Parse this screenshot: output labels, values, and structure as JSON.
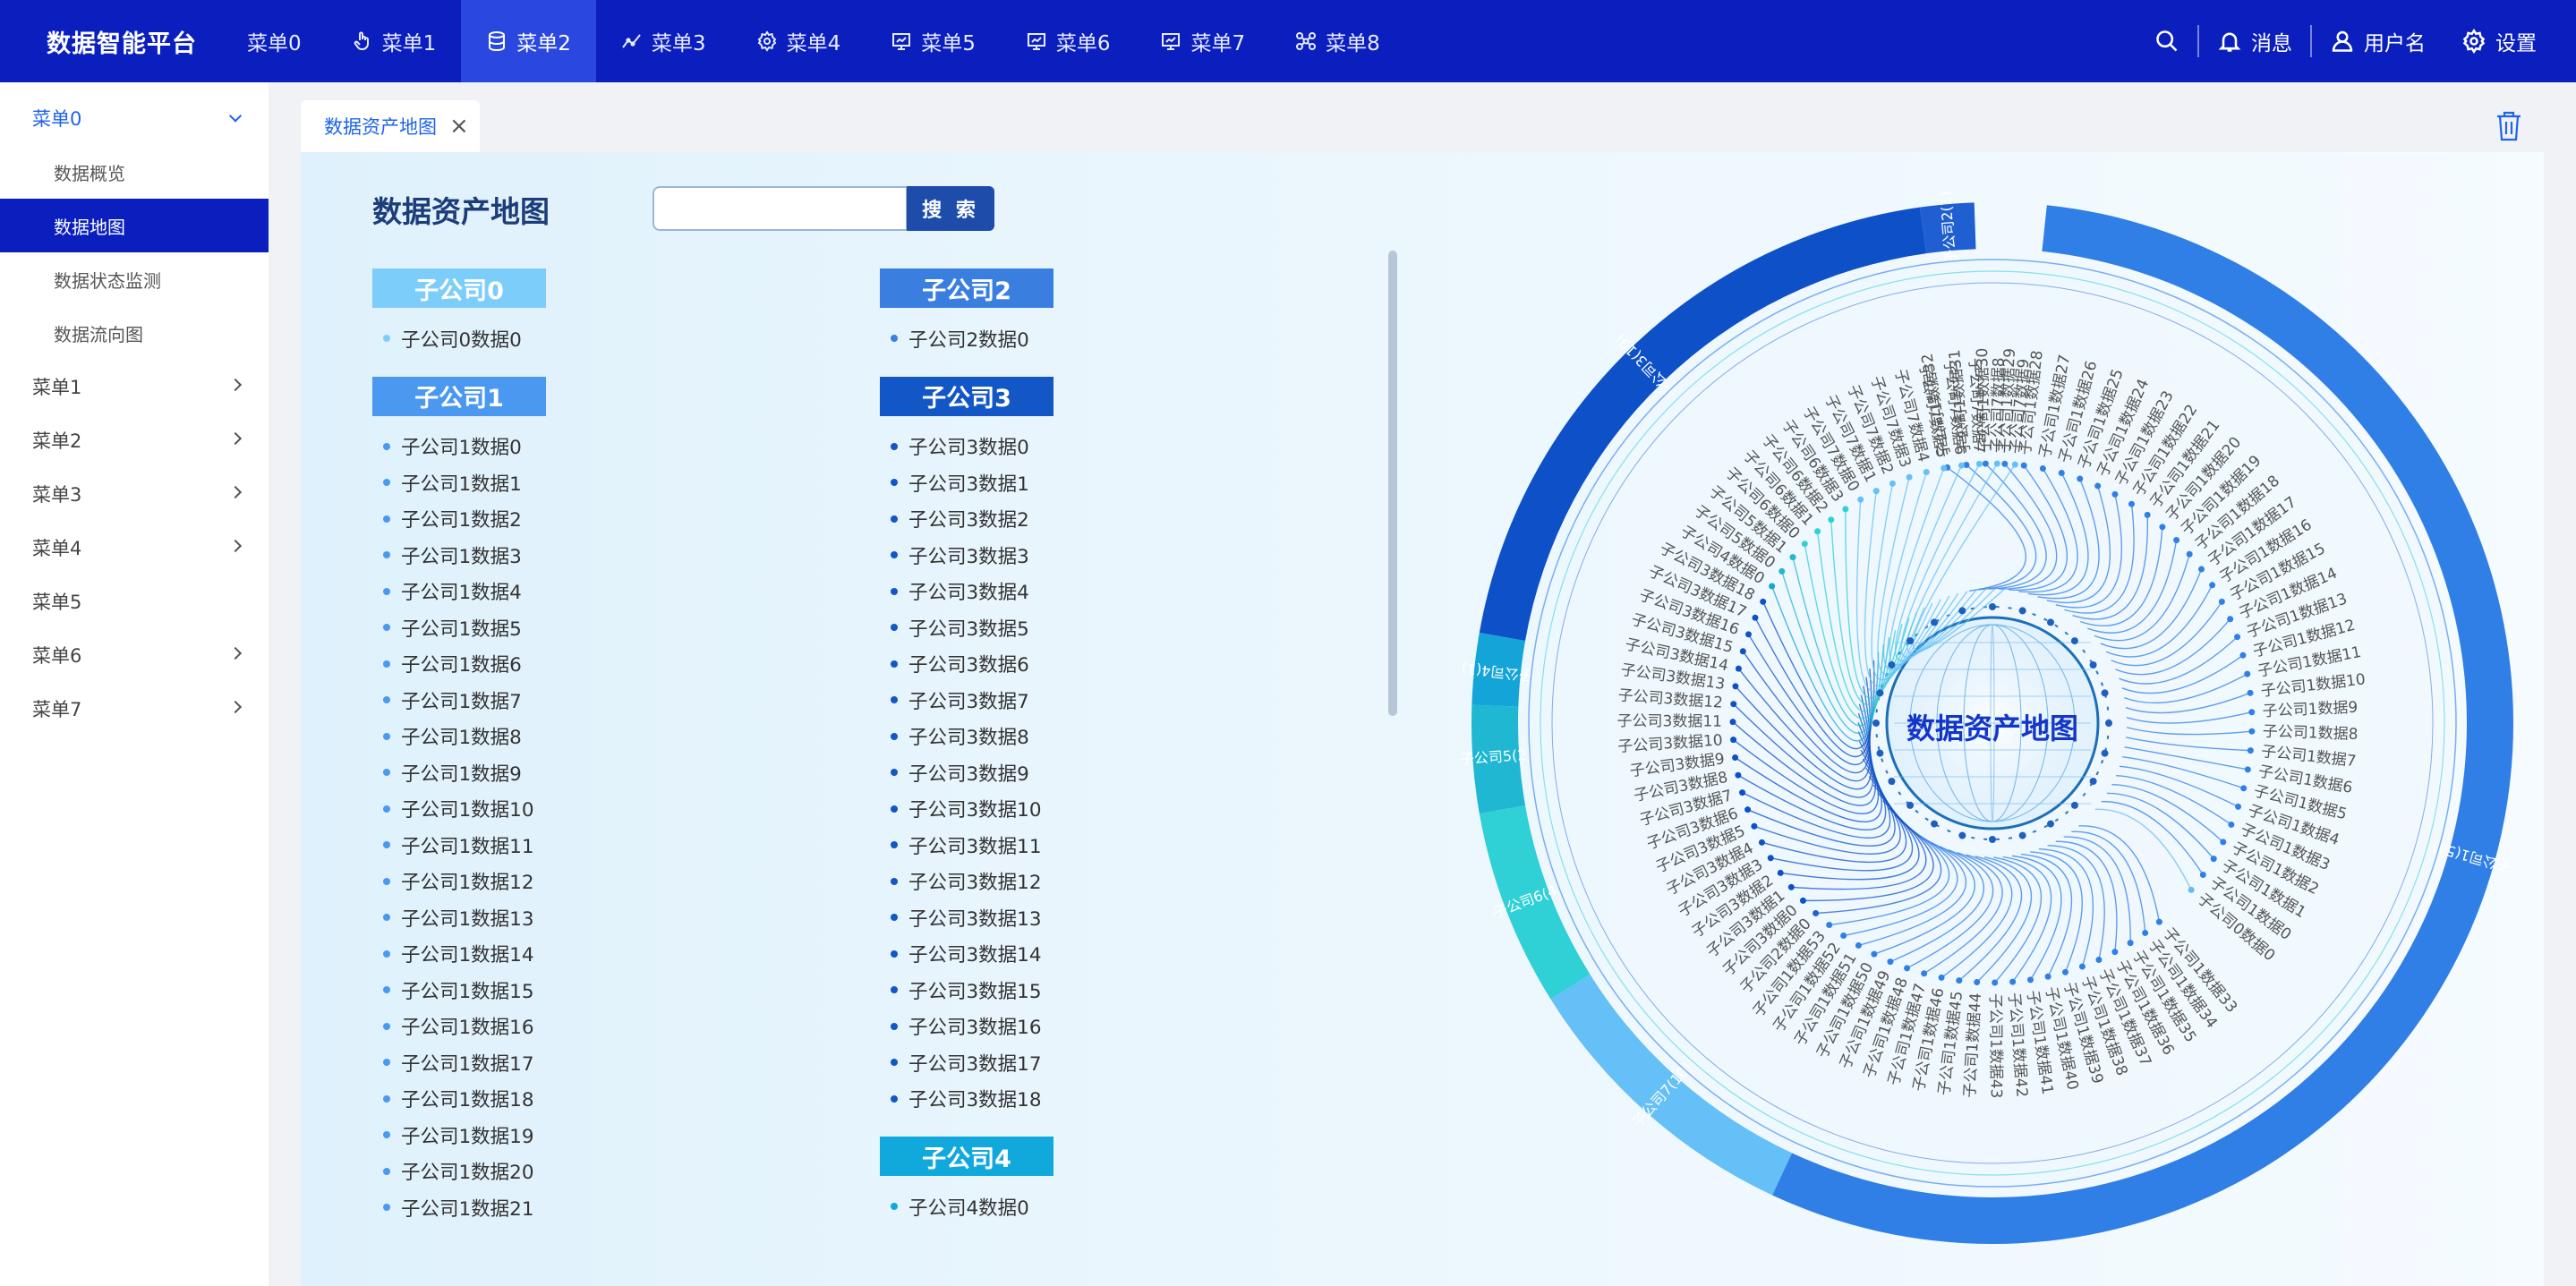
{
  "app": {
    "title": "数据智能平台"
  },
  "top_nav": [
    {
      "label": "菜单0",
      "icon": "none"
    },
    {
      "label": "菜单1",
      "icon": "hand-pointer-icon"
    },
    {
      "label": "菜单2",
      "icon": "database-icon",
      "active": true
    },
    {
      "label": "菜单3",
      "icon": "line-chart-icon"
    },
    {
      "label": "菜单4",
      "icon": "settings-icon"
    },
    {
      "label": "菜单5",
      "icon": "monitor-icon"
    },
    {
      "label": "菜单6",
      "icon": "monitor-icon"
    },
    {
      "label": "菜单7",
      "icon": "monitor-icon"
    },
    {
      "label": "菜单8",
      "icon": "cluster-icon"
    }
  ],
  "header_right": {
    "messages": "消息",
    "user": "用户名",
    "settings": "设置"
  },
  "sidebar": {
    "items": [
      {
        "label": "菜单0",
        "open": true,
        "children": [
          "数据概览",
          "数据地图",
          "数据状态监测",
          "数据流向图"
        ],
        "active_child": 1
      },
      {
        "label": "菜单1",
        "has_children": true
      },
      {
        "label": "菜单2",
        "has_children": true
      },
      {
        "label": "菜单3",
        "has_children": true
      },
      {
        "label": "菜单4",
        "has_children": true
      },
      {
        "label": "菜单5",
        "has_children": false
      },
      {
        "label": "菜单6",
        "has_children": true
      },
      {
        "label": "菜单7",
        "has_children": true
      }
    ]
  },
  "tab": {
    "label": "数据资产地图"
  },
  "page": {
    "title": "数据资产地图",
    "search_placeholder": "",
    "search_button": "搜 索"
  },
  "colors": {
    "accent": "#0b1fbf",
    "c0": "#7dcdfb",
    "c1": "#4a98f0",
    "c2": "#3a7fe0",
    "c3": "#1356c6",
    "c4": "#11a8dc",
    "c5": "#1fb4d6",
    "c6": "#3bd6d8",
    "c7": "#6fc2f5"
  },
  "groups_left": [
    {
      "name": "子公司0",
      "color": "#7dcdfb",
      "items": [
        "子公司0数据0"
      ]
    },
    {
      "name": "子公司1",
      "color": "#4a98f0",
      "items": [
        "子公司1数据0",
        "子公司1数据1",
        "子公司1数据2",
        "子公司1数据3",
        "子公司1数据4",
        "子公司1数据5",
        "子公司1数据6",
        "子公司1数据7",
        "子公司1数据8",
        "子公司1数据9",
        "子公司1数据10",
        "子公司1数据11",
        "子公司1数据12",
        "子公司1数据13",
        "子公司1数据14",
        "子公司1数据15",
        "子公司1数据16",
        "子公司1数据17",
        "子公司1数据18",
        "子公司1数据19",
        "子公司1数据20",
        "子公司1数据21"
      ]
    }
  ],
  "groups_right": [
    {
      "name": "子公司2",
      "color": "#3a7fe0",
      "items": [
        "子公司2数据0"
      ]
    },
    {
      "name": "子公司3",
      "color": "#1356c6",
      "items": [
        "子公司3数据0",
        "子公司3数据1",
        "子公司3数据2",
        "子公司3数据3",
        "子公司3数据4",
        "子公司3数据5",
        "子公司3数据6",
        "子公司3数据7",
        "子公司3数据8",
        "子公司3数据9",
        "子公司3数据10",
        "子公司3数据11",
        "子公司3数据12",
        "子公司3数据13",
        "子公司3数据14",
        "子公司3数据15",
        "子公司3数据16",
        "子公司3数据17",
        "子公司3数据18"
      ]
    },
    {
      "name": "子公司4",
      "color": "#11a8dc",
      "items": [
        "子公司4数据0"
      ]
    }
  ],
  "radial": {
    "center_label": "数据资产地图",
    "companies": [
      {
        "name": "子公司1",
        "count": 54,
        "color": "#2f7fe6",
        "label": "子公司1(54)"
      },
      {
        "name": "子公司0",
        "count": 1,
        "color": "#6bb8f3",
        "label": "子公司0(1)"
      },
      {
        "name": "子公司2",
        "count": 1,
        "color": "#1f5fd2",
        "label": "子公司2(1)"
      },
      {
        "name": "子公司3",
        "count": 19,
        "color": "#0d50c8",
        "label": "子公司3(19)"
      },
      {
        "name": "子公司4",
        "count": 1,
        "color": "#13a4d8",
        "label": "子公司4(1)"
      },
      {
        "name": "子公司5",
        "count": 2,
        "color": "#1fb7d2",
        "label": "子公司5(2)"
      },
      {
        "name": "子公司6",
        "count": 4,
        "color": "#2fd0d6",
        "label": "子公司6(4)"
      },
      {
        "name": "子公司7",
        "count": 10,
        "color": "#64c0f6",
        "label": "子公司7(10)"
      }
    ],
    "leaves_right": [
      "子公司1数据32",
      "子公司1数据31",
      "子公司1数据30",
      "子公司1数据29",
      "子公司1数据28",
      "子公司1数据27",
      "子公司1数据26",
      "子公司1数据25",
      "子公司1数据24",
      "子公司1数据23",
      "子公司1数据22",
      "子公司1数据21",
      "子公司1数据20",
      "子公司1数据19",
      "子公司1数据18",
      "子公司1数据17",
      "子公司1数据16",
      "子公司1数据15",
      "子公司1数据14",
      "子公司1数据13",
      "子公司1数据12",
      "子公司1数据11",
      "子公司1数据10",
      "子公司1数据9",
      "子公司1数据8",
      "子公司1数据7",
      "子公司1数据6",
      "子公司1数据5",
      "子公司1数据4",
      "子公司1数据3",
      "子公司1数据2",
      "子公司1数据1",
      "子公司1数据0",
      "子公司0数据0"
    ],
    "leaves_left": [
      "子公司1数据33",
      "子公司1数据34",
      "子公司1数据35",
      "子公司1数据36",
      "子公司1数据37",
      "子公司1数据38",
      "子公司1数据39",
      "子公司1数据40",
      "子公司1数据41",
      "子公司1数据42",
      "子公司1数据43",
      "子公司1数据44",
      "子公司1数据45",
      "子公司1数据46",
      "子公司1数据47",
      "子公司1数据48",
      "子公司1数据49",
      "子公司1数据50",
      "子公司1数据51",
      "子公司1数据52",
      "子公司1数据53",
      "子公司2数据0",
      "子公司3数据0",
      "子公司3数据1",
      "子公司3数据2",
      "子公司3数据3",
      "子公司3数据4",
      "子公司3数据5",
      "子公司3数据6",
      "子公司3数据7",
      "子公司3数据8",
      "子公司3数据9",
      "子公司3数据10",
      "子公司3数据11",
      "子公司3数据12",
      "子公司3数据13",
      "子公司3数据14",
      "子公司3数据15",
      "子公司3数据16",
      "子公司3数据17",
      "子公司3数据18",
      "子公司4数据0",
      "子公司5数据0",
      "子公司5数据1",
      "子公司6数据0",
      "子公司6数据1",
      "子公司6数据2",
      "子公司6数据3",
      "子公司7数据0",
      "子公司7数据1",
      "子公司7数据2",
      "子公司7数据3",
      "子公司7数据4",
      "子公司7数据5",
      "子公司7数据6",
      "子公司7数据7",
      "子公司7数据8",
      "子公司7数据9"
    ]
  }
}
